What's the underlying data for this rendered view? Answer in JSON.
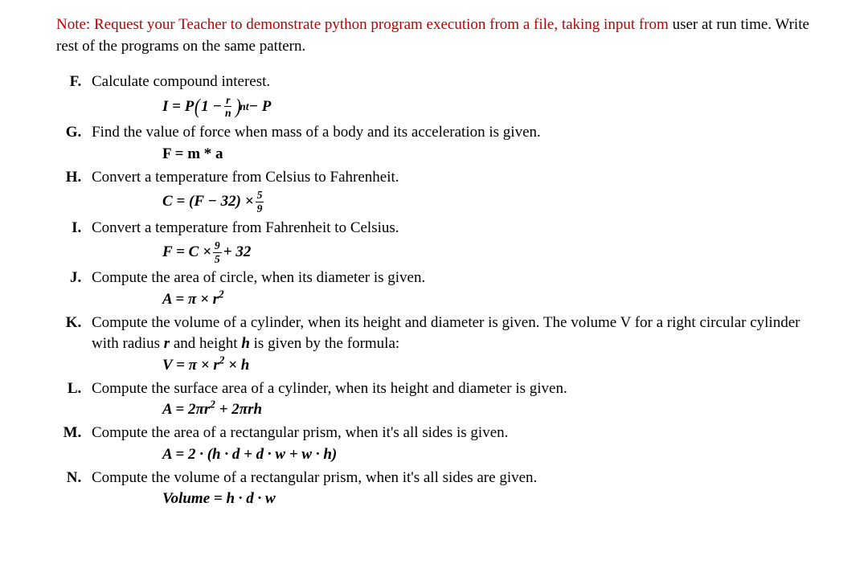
{
  "note": {
    "red_text": "Note: Request your Teacher to demonstrate python program execution from a file, taking input from ",
    "black_text": "user at run time. Write rest of the programs on the same pattern."
  },
  "exercises": {
    "F": {
      "text": "Calculate compound interest.",
      "formula": {
        "pre": "I  =  P",
        "lp": "(",
        "inner_left": "1 − ",
        "frac_num": "r",
        "frac_den": "n",
        "rp": ")",
        "exp": "nt",
        "post": "  −  P"
      }
    },
    "G": {
      "text": "Find the value of force when mass of a body and its acceleration is given.",
      "formula_plain": "F = m * a"
    },
    "H": {
      "text": "Convert a temperature from Celsius to Fahrenheit.",
      "formula": {
        "left": "C  =  (F − 32) × ",
        "frac_num": "5",
        "frac_den": "9"
      }
    },
    "I": {
      "text": "Convert a temperature from Fahrenheit to Celsius.",
      "formula": {
        "left": "F  =  C × ",
        "frac_num": "9",
        "frac_den": "5",
        "right": " + 32"
      }
    },
    "J": {
      "text": "Compute the area of circle, when its diameter is given.",
      "formula": {
        "left": "A  =  π  ×  r",
        "exp": "2"
      }
    },
    "K": {
      "text1": "Compute the volume of a cylinder, when its height and diameter is given. The volume V for a right circular cylinder with radius ",
      "bold1": "r",
      "text2": " and height ",
      "bold2": "h",
      "text3": " is given by the formula:",
      "formula": {
        "left": "V  =  π × r",
        "exp": "2",
        "right": "  ×  h"
      }
    },
    "L": {
      "text": "Compute the surface area of a cylinder, when its height and diameter is given.",
      "formula": {
        "left": "A  =  2πr",
        "exp": "2",
        "right": "  +  2πrh"
      }
    },
    "M": {
      "text": "Compute the area of a rectangular prism, when it's all sides is given.",
      "formula_plain": "A  =  2 · (h · d  +  d · w  +  w · h)"
    },
    "N": {
      "text": "Compute the volume of a rectangular prism, when it's all sides are given.",
      "formula_plain": "Volume  =  h · d · w"
    }
  }
}
